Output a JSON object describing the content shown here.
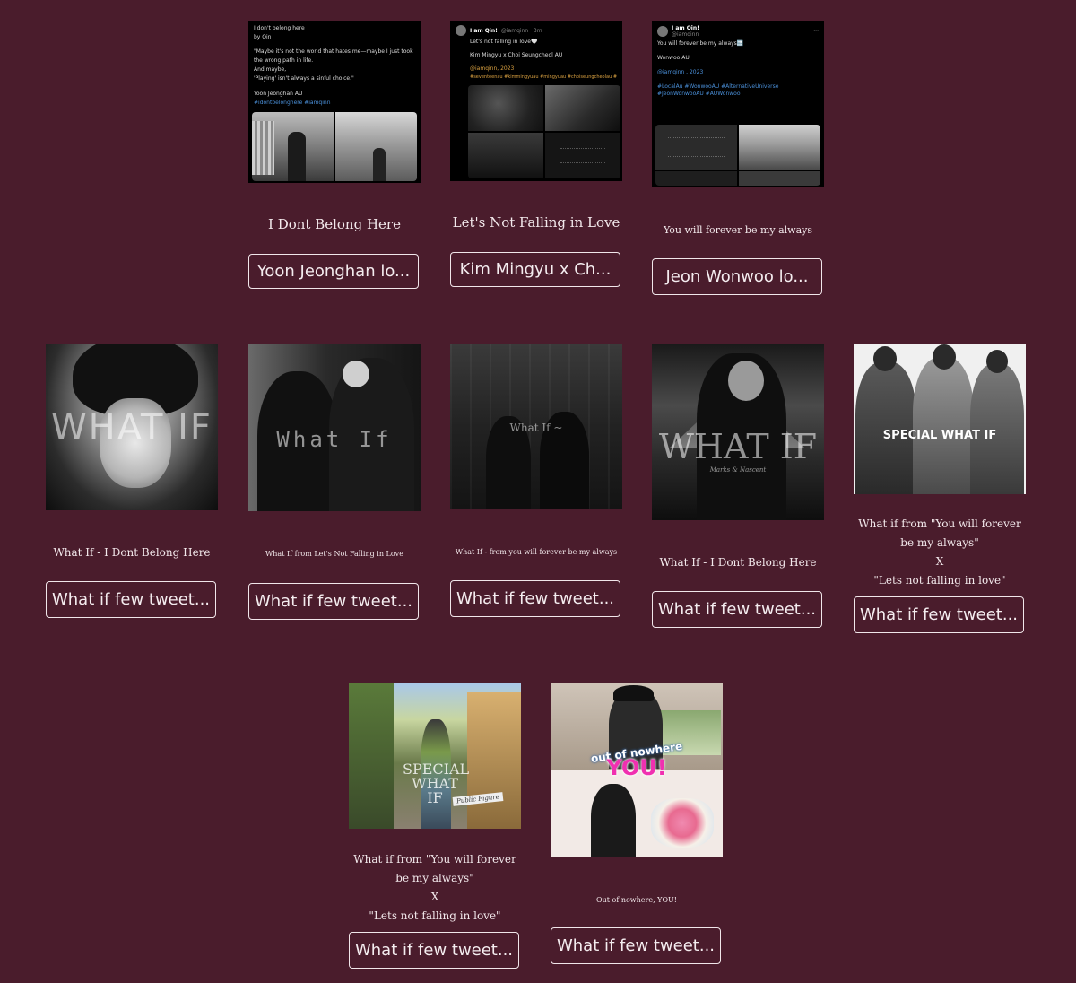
{
  "row1": [
    {
      "tweet": {
        "lines": [
          "I don't belong here",
          "by Qin",
          "",
          "\"Maybe it's not the world that hates me—maybe I just took",
          "the wrong path in life.",
          "And maybe,",
          "'Playing' isn't always a sinful choice.\"",
          "",
          "Yoon Jeonghan AU"
        ],
        "tags": "#idontbelonghere #iamqinn"
      },
      "title": "I Dont Belong Here",
      "button": "Yoon Jeonghan lo..."
    },
    {
      "tweet": {
        "name": "I am Qin!",
        "handle": "@iamqinn · 3m",
        "lines": [
          "Let's not falling in love🤍",
          "",
          "Kim Mingyu x Choi Seungcheol AU",
          "",
          "@iamqinn, 2023"
        ],
        "tags": "#seventeenau #kimmingyuau #mingyuau #choiseungcheolau #seungcheolau"
      },
      "title": "Let's Not Falling in Love",
      "button": "Kim Mingyu x Ch..."
    },
    {
      "tweet": {
        "name": "I am Qin!",
        "handle": "@iamqinn",
        "lines": [
          "You will forever be my always🔜",
          "",
          "Wonwoo AU",
          "",
          "@iamqinn , 2023",
          ""
        ],
        "tags": "#LocalAu #WonwooAU #AlternativeUniverse #JeonWonwooAU #AUWonwoo"
      },
      "title": "You will forever be my always",
      "button": "Jeon Wonwoo lo..."
    }
  ],
  "row2": [
    {
      "overlay": "WHAT IF",
      "title": "What If - I Dont Belong Here",
      "button": "What if few tweet..."
    },
    {
      "overlay": "What If",
      "title": "What If from Let's Not Falling in Love",
      "button": "What if few tweet..."
    },
    {
      "overlay": "What If ~",
      "title": "What If - from you will forever be my always",
      "button": "What if few tweet..."
    },
    {
      "overlay": "WHAT IF",
      "overlay_sub": "Marks & Nascent",
      "title": "What If - I Dont Belong Here",
      "button": "What if few tweet..."
    },
    {
      "overlay": "SPECIAL WHAT IF",
      "title_lines": [
        "What if from \"You will forever",
        "be my always\"",
        "X",
        "\"Lets not falling in love\""
      ],
      "button": "What if few tweet..."
    }
  ],
  "row3": [
    {
      "overlay": "SPECIAL WHAT IF",
      "overlay_sub": "Public Figure",
      "title_lines": [
        "What if from \"You will forever",
        "be my always\"",
        "X",
        "\"Lets not falling in love\""
      ],
      "button": "What if few tweet..."
    },
    {
      "overlay_top": "out of nowhere",
      "overlay_big": "YOU!",
      "title": "Out of nowhere, YOU!",
      "button": "What if few tweet..."
    }
  ],
  "colors": {
    "background": "#4a1c2c",
    "button_border": "#f1e6ea",
    "hashtag": "#4a8fd8"
  }
}
